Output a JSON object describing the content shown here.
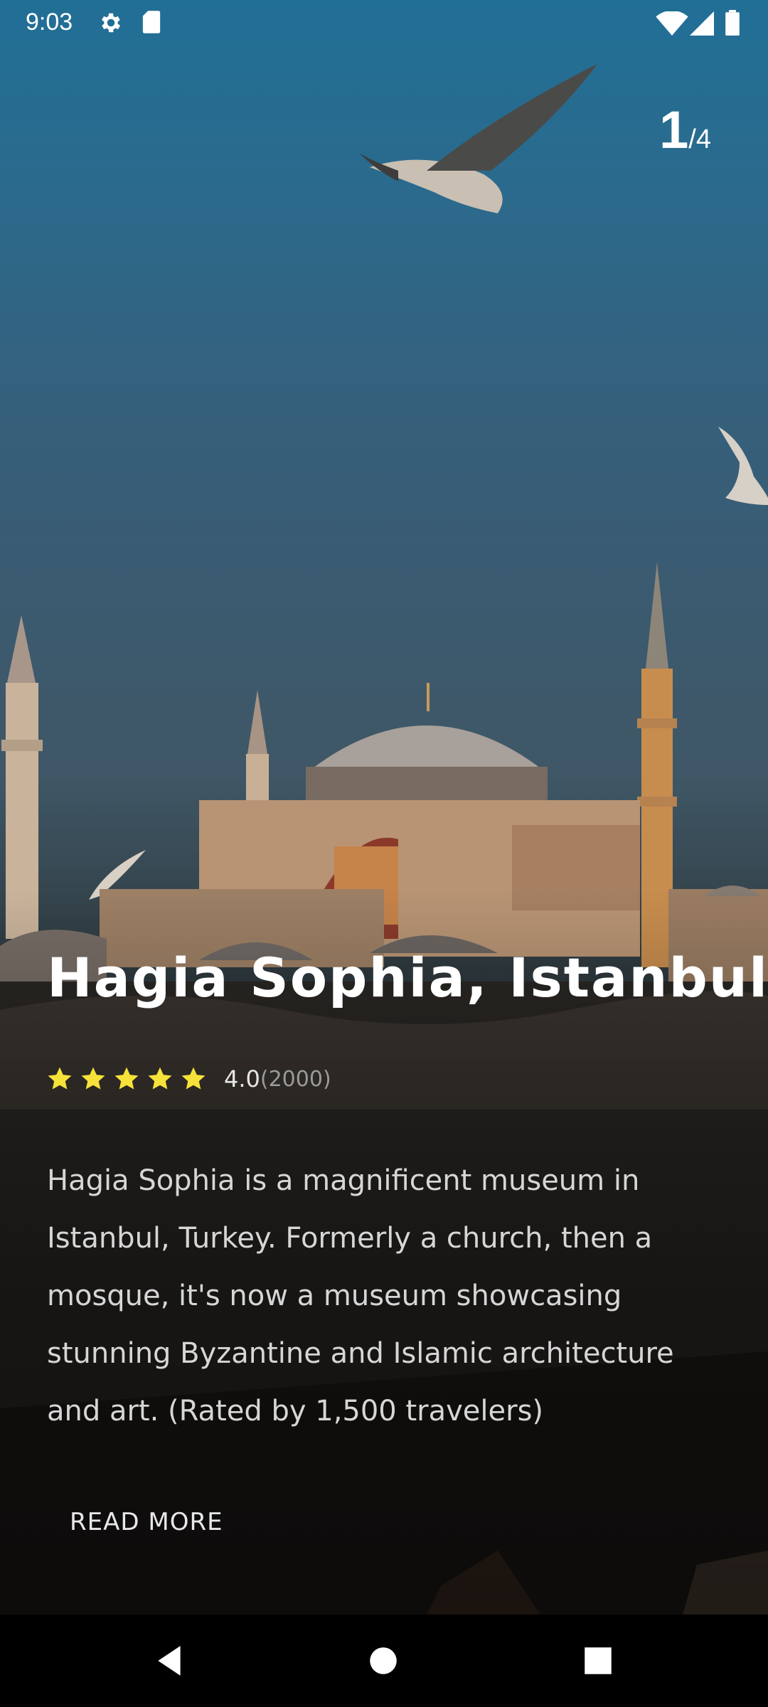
{
  "status_bar": {
    "time": "9:03",
    "icons": [
      "settings-gear-icon",
      "sd-card-icon",
      "wifi-icon",
      "cell-signal-icon",
      "battery-icon"
    ]
  },
  "pager": {
    "current": "1",
    "total": "/4"
  },
  "place": {
    "title": "Hagia Sophia, Istanbul",
    "stars": 5,
    "rating_value": "4.0",
    "rating_count": "(2000)",
    "description": "Hagia Sophia is a magnificent museum in Istanbul, Turkey. Formerly a church, then a mosque, it's now a museum showcasing stunning Byzantine and Islamic architecture and art. (Rated by 1,500 travelers)",
    "read_more_label": "READ MORE"
  },
  "colors": {
    "star": "#f7e23a",
    "sky_top": "#216f97",
    "text_primary": "#ffffff"
  },
  "nav_bar": {
    "buttons": [
      "back-icon",
      "home-icon",
      "recents-icon"
    ]
  }
}
